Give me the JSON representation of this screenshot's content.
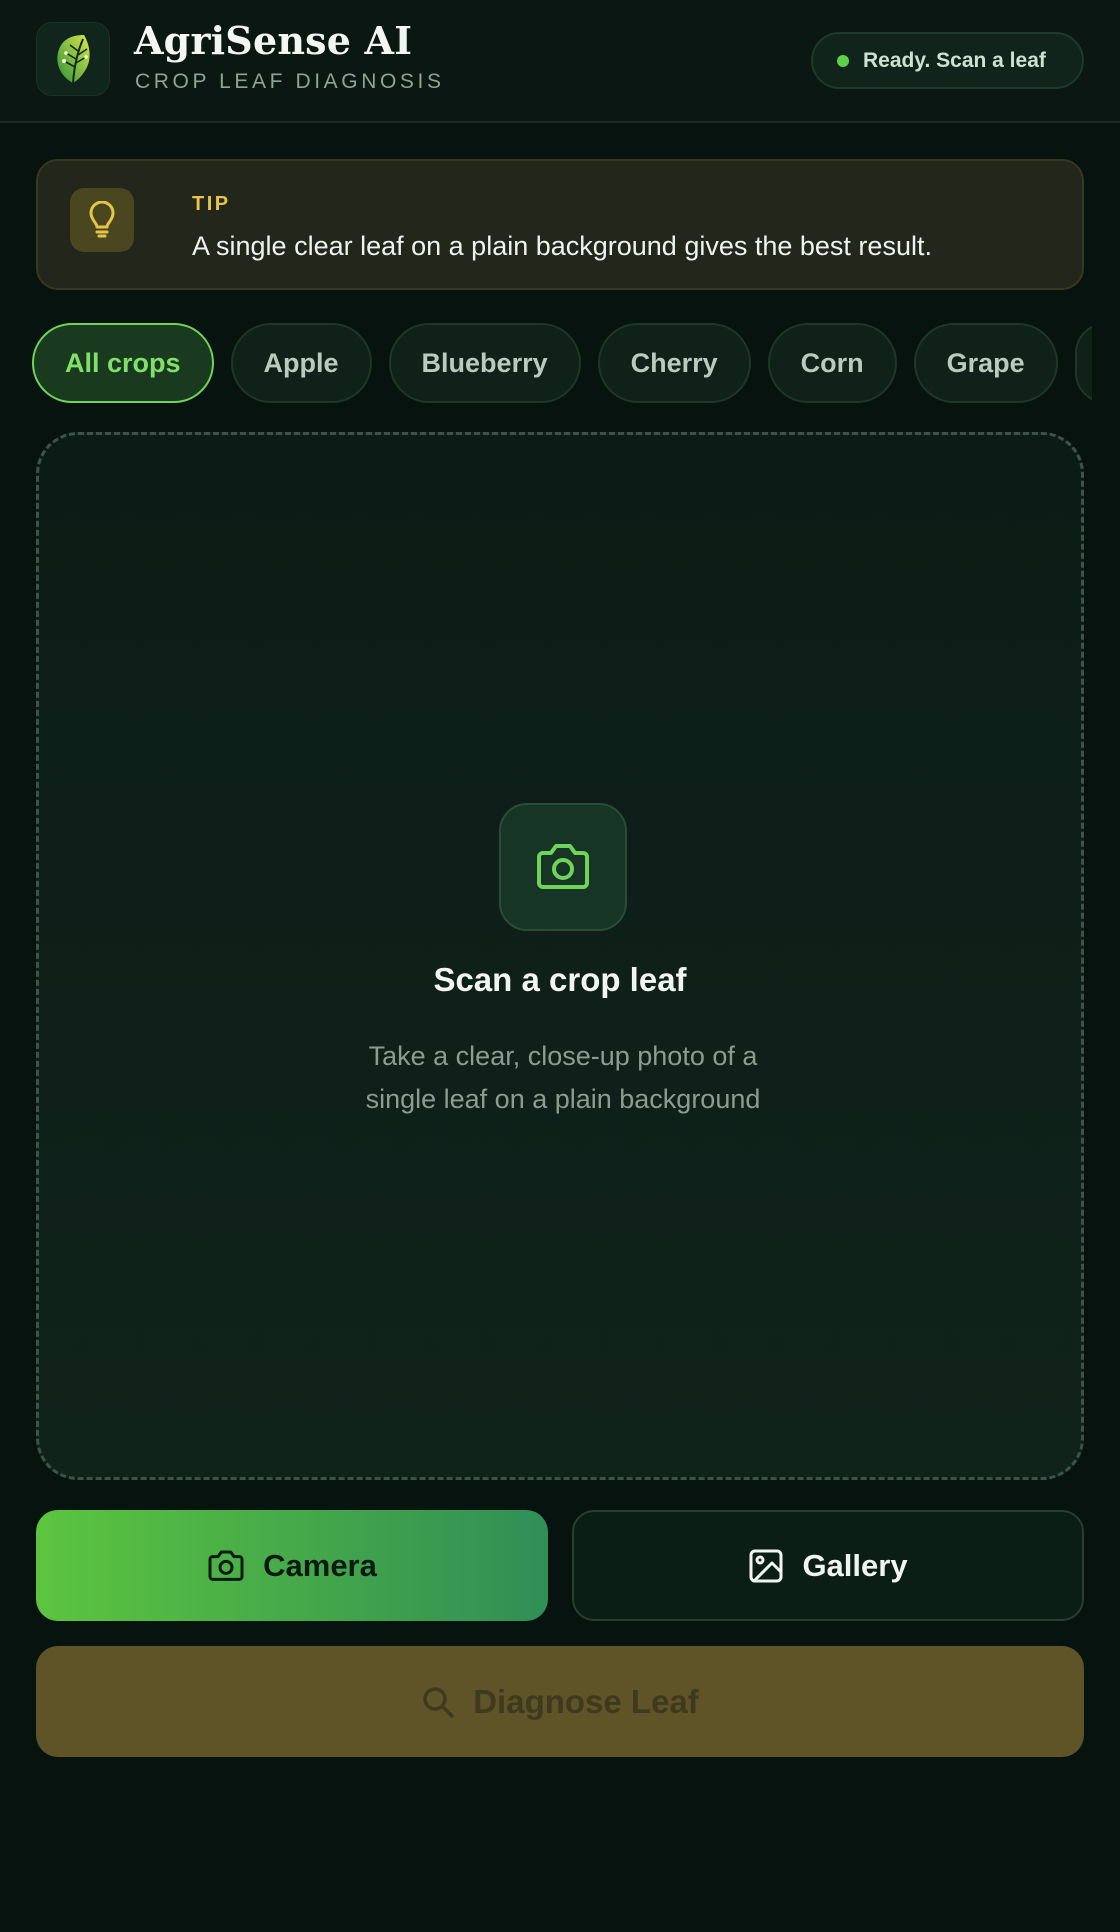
{
  "header": {
    "title": "AgriSense AI",
    "subtitle": "CROP LEAF DIAGNOSIS",
    "logo_icon": "leaf-icon",
    "status": "Ready. Scan a leaf",
    "status_color": "#5fce4a"
  },
  "tip": {
    "label": "TIP",
    "text": "A single clear leaf on a plain background gives the best result.",
    "icon": "lightbulb-icon"
  },
  "filters": {
    "selected": "All crops",
    "chips": [
      "All crops",
      "Apple",
      "Blueberry",
      "Cherry",
      "Corn",
      "Grape"
    ]
  },
  "scan": {
    "icon": "camera-icon",
    "title": "Scan a crop leaf",
    "description": "Take a clear, close-up photo of a single leaf on a plain background"
  },
  "actions": {
    "camera_label": "Camera",
    "gallery_label": "Gallery",
    "diagnose_label": "Diagnose Leaf"
  },
  "colors": {
    "accent": "#6fd45a",
    "background": "#07130f",
    "tip": "#e6c64a",
    "diagnose_disabled": "#5e5427"
  }
}
